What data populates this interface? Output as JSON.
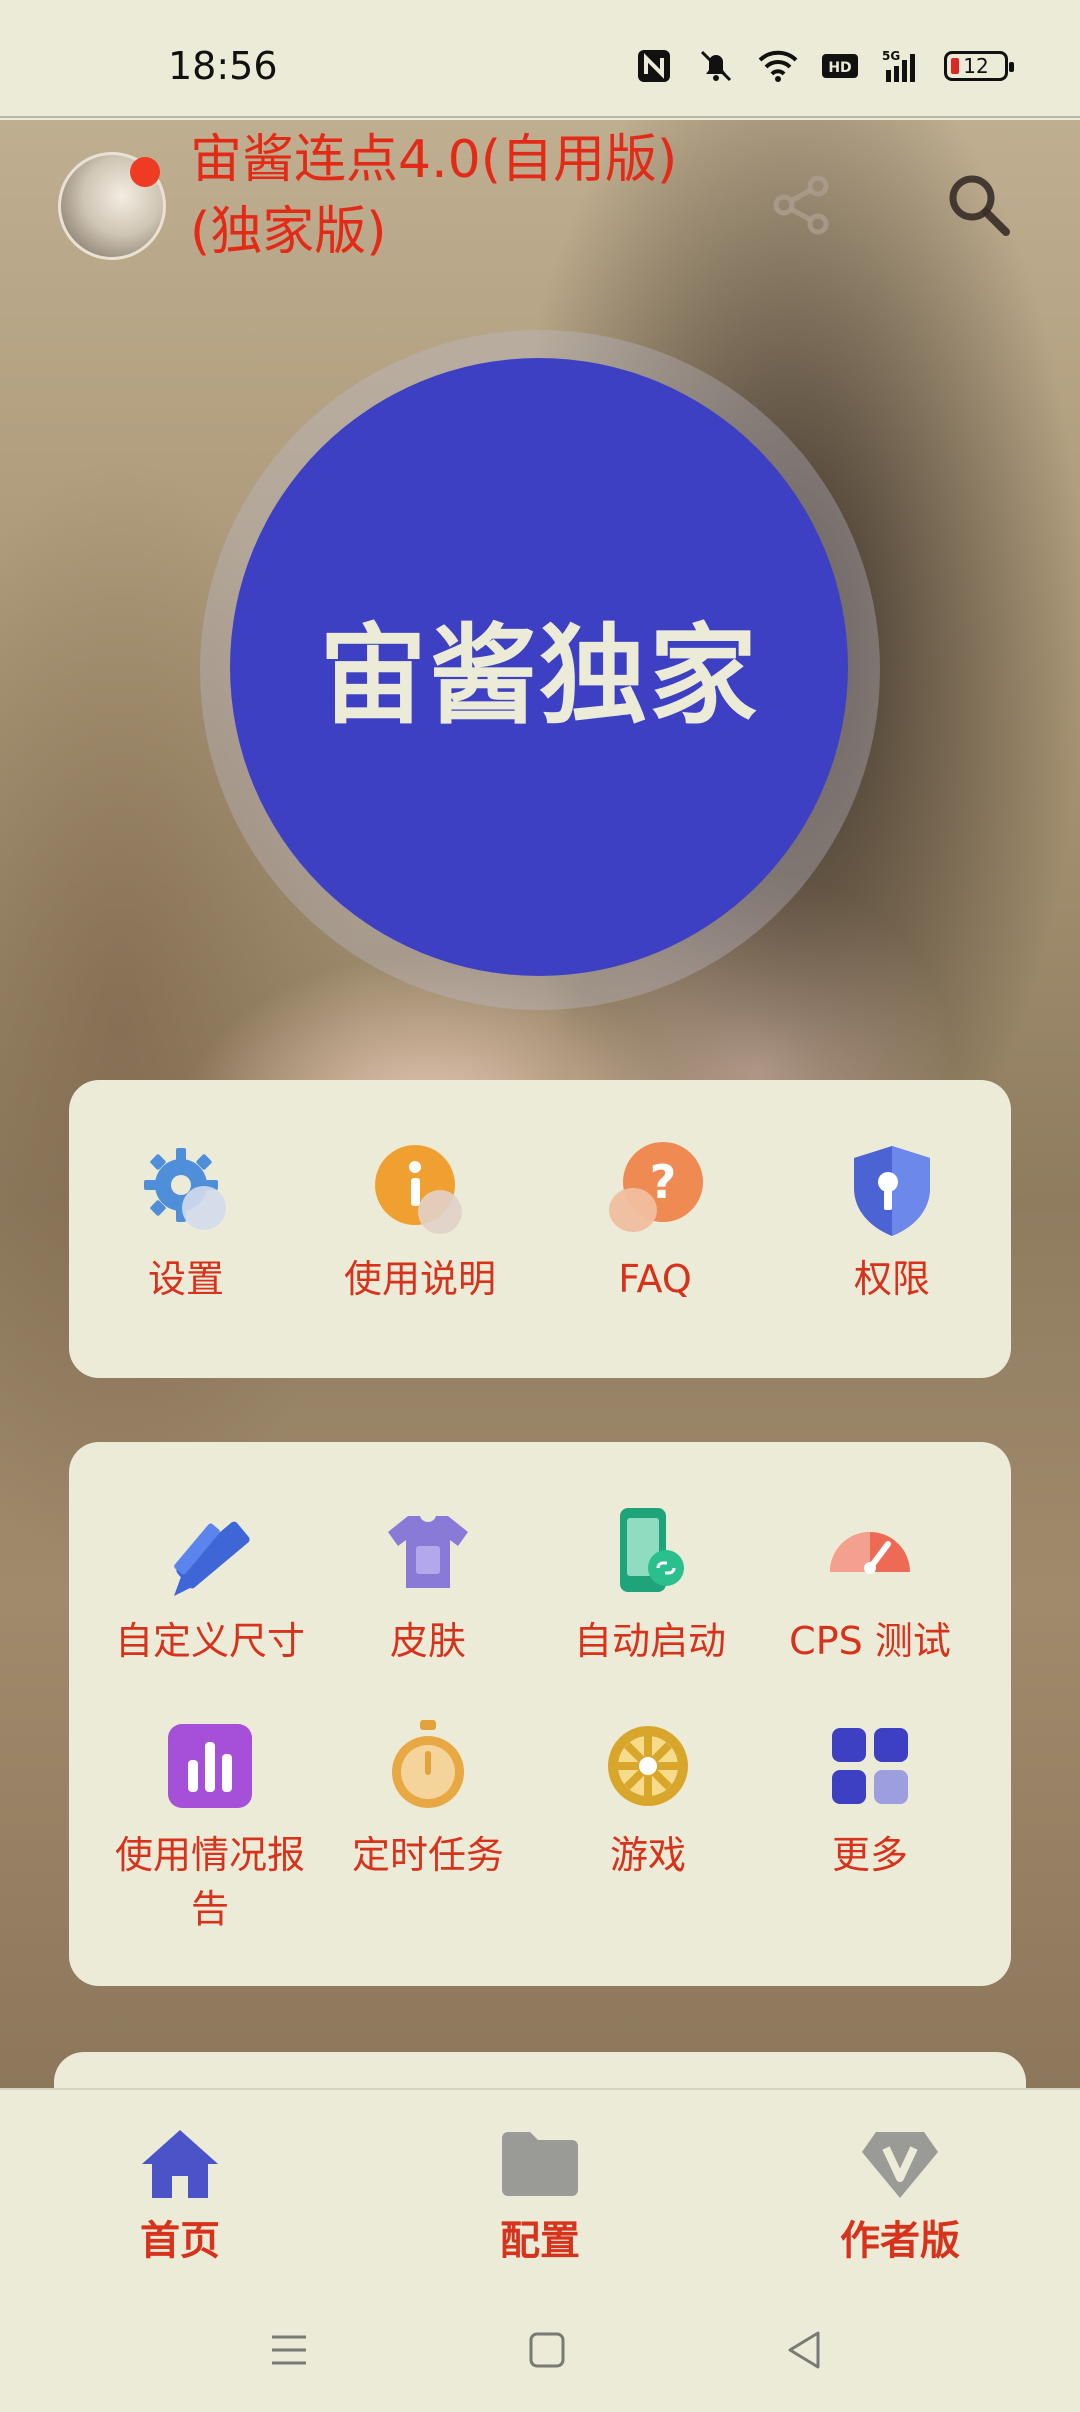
{
  "status_bar": {
    "time": "18:56",
    "battery": "12",
    "icons": [
      "nfc-icon",
      "mute-icon",
      "wifi-icon",
      "hd-icon",
      "signal-5g-icon",
      "battery-icon"
    ]
  },
  "header": {
    "title": "宙酱连点4.0(自用版)(独家版)",
    "share_icon": "share-icon",
    "search_icon": "search-icon"
  },
  "main_button": {
    "label": "宙酱独家",
    "color": "#3e40c3"
  },
  "card1": {
    "items": [
      {
        "label": "设置",
        "icon": "gear-icon"
      },
      {
        "label": "使用说明",
        "icon": "info-icon"
      },
      {
        "label": "FAQ",
        "icon": "question-icon"
      },
      {
        "label": "权限",
        "icon": "shield-key-icon"
      }
    ]
  },
  "card2": {
    "items": [
      {
        "label": "自定义尺寸",
        "icon": "ruler-pencil-icon"
      },
      {
        "label": "皮肤",
        "icon": "tshirt-icon"
      },
      {
        "label": "自动启动",
        "icon": "phone-link-icon"
      },
      {
        "label": "CPS 测试",
        "icon": "speedometer-icon"
      },
      {
        "label": "使用情况报告",
        "icon": "bar-chart-icon"
      },
      {
        "label": "定时任务",
        "icon": "stopwatch-icon"
      },
      {
        "label": "游戏",
        "icon": "wheel-icon"
      },
      {
        "label": "更多",
        "icon": "grid-icon"
      }
    ]
  },
  "bottom_nav": {
    "items": [
      {
        "label": "首页",
        "icon": "home-icon",
        "active": true
      },
      {
        "label": "配置",
        "icon": "folder-icon",
        "active": false
      },
      {
        "label": "作者版",
        "icon": "diamond-v-icon",
        "active": false
      }
    ]
  },
  "colors": {
    "accent_red": "#d6321c",
    "primary_blue": "#3e40c3",
    "surface": "#ecebd7"
  }
}
